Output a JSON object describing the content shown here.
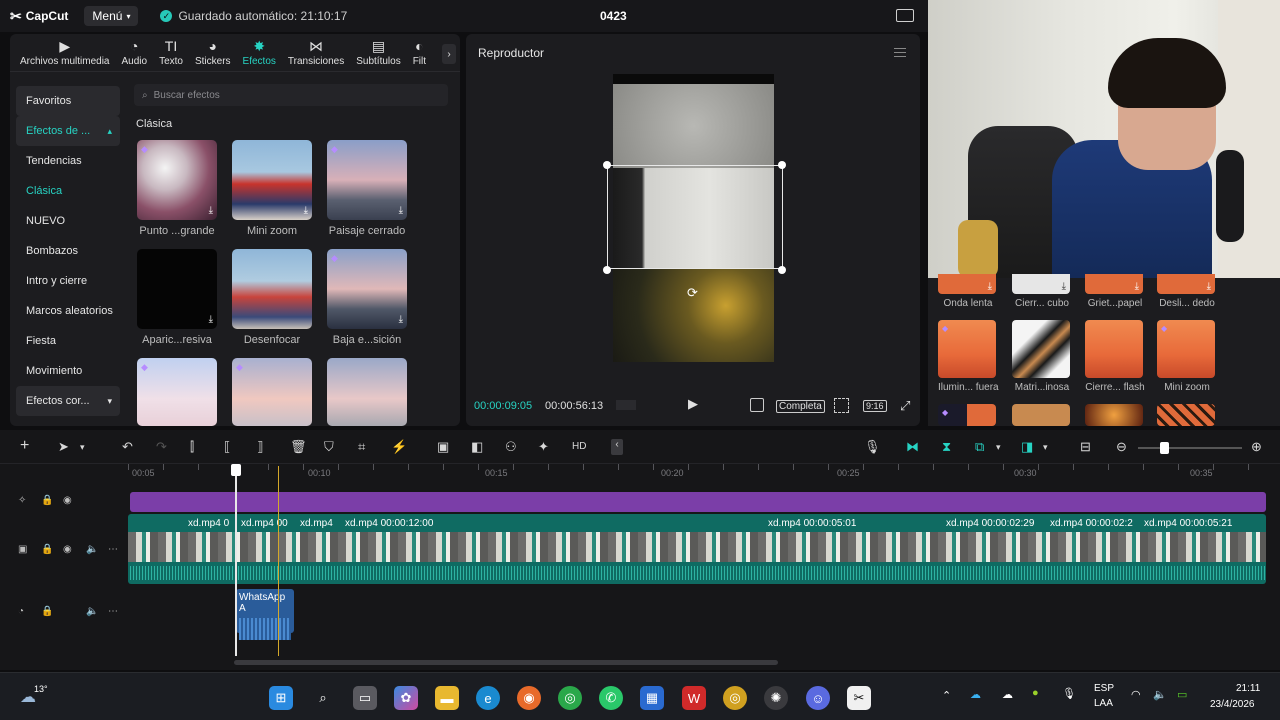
{
  "app": {
    "name": "CapCut",
    "menu_label": "Menú",
    "autosave": "Guardado automático: 21:10:17",
    "project_title": "0423"
  },
  "tabs": [
    {
      "label": "Archivos multimedia",
      "icon": "media-icon"
    },
    {
      "label": "Audio",
      "icon": "audio-icon"
    },
    {
      "label": "Texto",
      "icon": "text-icon"
    },
    {
      "label": "Stickers",
      "icon": "sticker-icon"
    },
    {
      "label": "Efectos",
      "icon": "effects-icon",
      "active": true
    },
    {
      "label": "Transiciones",
      "icon": "transitions-icon"
    },
    {
      "label": "Subtítulos",
      "icon": "subtitles-icon"
    },
    {
      "label": "Filt",
      "icon": "filters-icon"
    }
  ],
  "categories": [
    {
      "label": "Favoritos",
      "style": "box"
    },
    {
      "label": "Efectos de ...",
      "style": "teal-box"
    },
    {
      "label": "Tendencias"
    },
    {
      "label": "Clásica",
      "style": "teal"
    },
    {
      "label": "NUEVO"
    },
    {
      "label": "Bombazos"
    },
    {
      "label": "Intro y cierre"
    },
    {
      "label": "Marcos aleatorios"
    },
    {
      "label": "Fiesta"
    },
    {
      "label": "Movimiento"
    },
    {
      "label": "Efectos cor...",
      "style": "box"
    }
  ],
  "search_placeholder": "Buscar efectos",
  "section_title": "Clásica",
  "effects": [
    {
      "label": "Punto ...grande"
    },
    {
      "label": "Mini zoom"
    },
    {
      "label": "Paisaje cerrado"
    },
    {
      "label": "Aparic...resiva"
    },
    {
      "label": "Desenfocar"
    },
    {
      "label": "Baja e...sición"
    },
    {
      "label": ""
    },
    {
      "label": ""
    },
    {
      "label": ""
    }
  ],
  "player": {
    "title": "Reproductor",
    "current_time": "00:00:09:05",
    "total_time": "00:00:56:13",
    "quality": "Completa",
    "ratio": "9:16"
  },
  "right_effects": [
    {
      "label": "Onda lenta"
    },
    {
      "label": "Cierr... cubo"
    },
    {
      "label": "Griet...papel"
    },
    {
      "label": "Desli... dedo"
    },
    {
      "label": "Ilumin... fuera"
    },
    {
      "label": "Matri...inosa"
    },
    {
      "label": "Cierre... flash"
    },
    {
      "label": "Mini zoom"
    }
  ],
  "ruler": [
    "00:05",
    "00:10",
    "00:15",
    "00:20",
    "00:25",
    "00:30",
    "00:35"
  ],
  "clips": [
    {
      "label": "xd.mp4  0"
    },
    {
      "label": "xd.mp4  00"
    },
    {
      "label": "xd.mp4"
    },
    {
      "label": "xd.mp4  00:00:12:00"
    },
    {
      "label": "xd.mp4  00:00:05:01"
    },
    {
      "label": "xd.mp4  00:00:02:29"
    },
    {
      "label": "xd.mp4  00:00:02:2"
    },
    {
      "label": "xd.mp4  00:00:05:21"
    }
  ],
  "audio_clip": "WhatsApp A",
  "taskbar": {
    "weather": "13°",
    "lang1": "ESP",
    "lang2": "LAA",
    "time": "21:11",
    "date": "23/4/2026"
  }
}
